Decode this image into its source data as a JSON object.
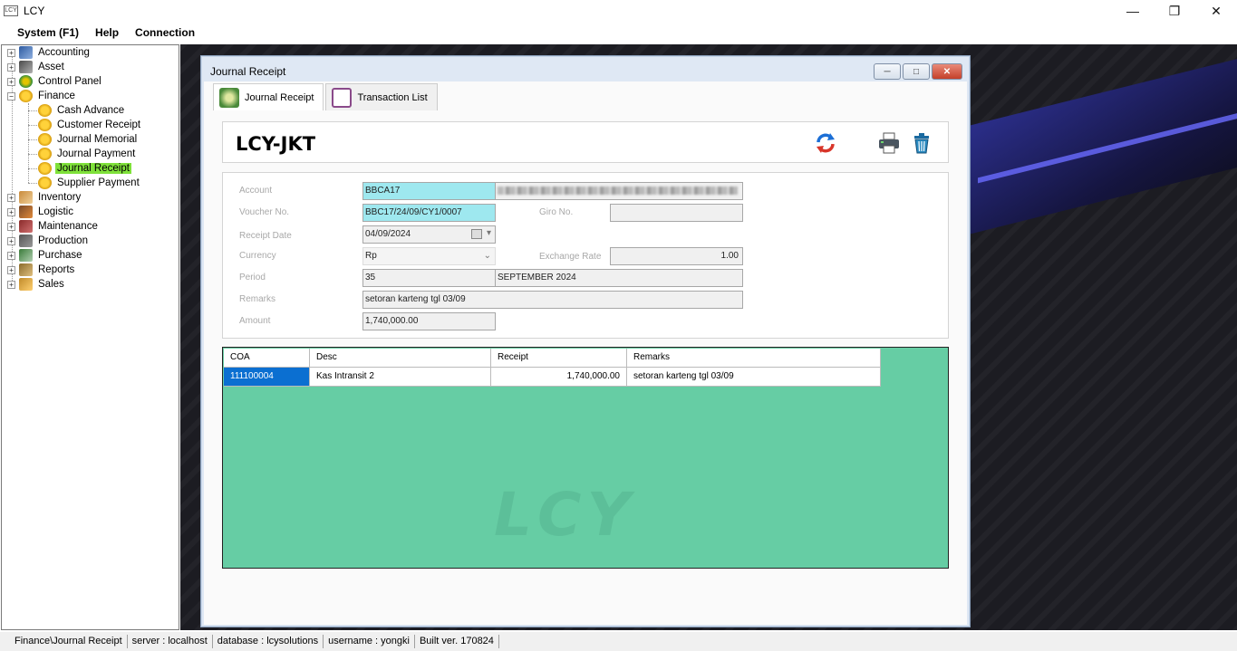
{
  "window": {
    "title": "LCY",
    "icon": "lcy-app-icon"
  },
  "menu": [
    "System (F1)",
    "Help",
    "Connection"
  ],
  "tree": {
    "roots": [
      {
        "label": "Accounting",
        "icon": "accounting-icon"
      },
      {
        "label": "Asset",
        "icon": "asset-icon"
      },
      {
        "label": "Control Panel",
        "icon": "control-panel-icon"
      },
      {
        "label": "Finance",
        "icon": "finance-icon"
      },
      {
        "label": "Inventory",
        "icon": "inventory-icon"
      },
      {
        "label": "Logistic",
        "icon": "logistic-icon"
      },
      {
        "label": "Maintenance",
        "icon": "maintenance-icon"
      },
      {
        "label": "Production",
        "icon": "production-icon"
      },
      {
        "label": "Purchase",
        "icon": "purchase-icon"
      },
      {
        "label": "Reports",
        "icon": "reports-icon"
      },
      {
        "label": "Sales",
        "icon": "sales-icon"
      }
    ],
    "finance_children": [
      "Cash Advance",
      "Customer Receipt",
      "Journal Memorial",
      "Journal Payment",
      "Journal Receipt",
      "Supplier Payment"
    ],
    "selected": "Journal Receipt"
  },
  "child_window": {
    "title": "Journal Receipt",
    "tabs": [
      {
        "label": "Journal Receipt",
        "icon": "money-icon",
        "active": true
      },
      {
        "label": "Transaction List",
        "icon": "clipboard-icon",
        "active": false
      }
    ]
  },
  "header": {
    "company": "LCY-JKT"
  },
  "form": {
    "account_label": "Account",
    "account_code": "BBCA17",
    "voucher_label": "Voucher No.",
    "voucher_value": "BBC17/24/09/CY1/0007",
    "giro_label": "Giro No.",
    "giro_value": "",
    "receipt_date_label": "Receipt Date",
    "receipt_date_value": "04/09/2024",
    "currency_label": "Currency",
    "currency_value": "Rp",
    "exchange_rate_label": "Exchange Rate",
    "exchange_rate_value": "1.00",
    "period_label": "Period",
    "period_no": "35",
    "period_name": "SEPTEMBER 2024",
    "remarks_label": "Remarks",
    "remarks_value": "setoran karteng tgl 03/09",
    "amount_label": "Amount",
    "amount_value": "1,740,000.00"
  },
  "grid": {
    "columns": [
      "COA",
      "Desc",
      "Receipt",
      "Remarks"
    ],
    "rows": [
      {
        "coa": "111100004",
        "desc": "Kas Intransit 2",
        "receipt": "1,740,000.00",
        "remarks": "setoran karteng tgl 03/09"
      }
    ],
    "watermark": "LCY"
  },
  "status": [
    "Finance\\Journal Receipt",
    "server : localhost",
    "database : lcysolutions",
    "username : yongki",
    "Built ver. 170824"
  ],
  "colors": {
    "selected_tree": "#7fe13a",
    "field_highlight": "#9ee8ef",
    "grid_background": "#66cda4",
    "grid_selection": "#0b6fd1"
  }
}
